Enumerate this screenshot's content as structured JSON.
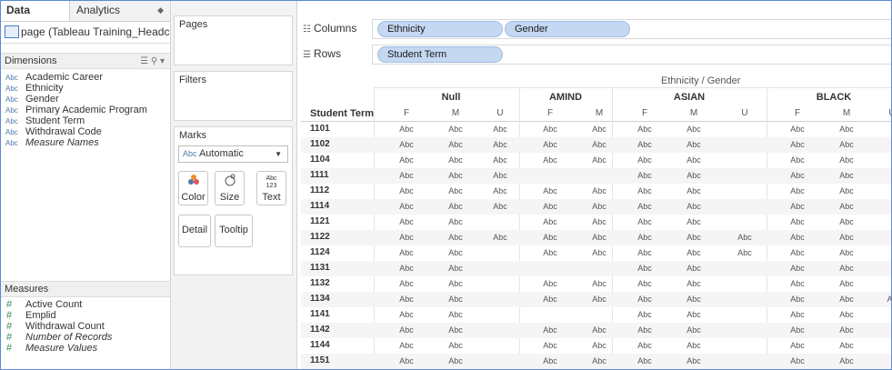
{
  "left_pane": {
    "tab_data": "Data",
    "tab_analytics": "Analytics",
    "datasource": "page (Tableau Training_Headc...",
    "dimensions_label": "Dimensions",
    "dimensions": [
      {
        "type": "Abc",
        "label": "Academic Career"
      },
      {
        "type": "Abc",
        "label": "Ethnicity"
      },
      {
        "type": "Abc",
        "label": "Gender"
      },
      {
        "type": "Abc",
        "label": "Primary Academic Program"
      },
      {
        "type": "Abc",
        "label": "Student Term"
      },
      {
        "type": "Abc",
        "label": "Withdrawal Code"
      },
      {
        "type": "Abc",
        "label": "Measure Names"
      }
    ],
    "measures_label": "Measures",
    "measures": [
      {
        "type": "#",
        "label": "Active Count"
      },
      {
        "type": "#",
        "label": "Emplid"
      },
      {
        "type": "#",
        "label": "Withdrawal Count"
      },
      {
        "type": "#",
        "label": "Number of Records"
      },
      {
        "type": "#",
        "label": "Measure Values"
      }
    ]
  },
  "cards": {
    "pages": "Pages",
    "filters": "Filters",
    "marks": "Marks",
    "mark_type_prefix": "Abc",
    "mark_type": "Automatic",
    "buttons": {
      "color": "Color",
      "size": "Size",
      "text": "Text",
      "detail": "Detail",
      "tooltip": "Tooltip"
    }
  },
  "shelves": {
    "columns_label": "Columns",
    "rows_label": "Rows",
    "columns": [
      "Ethnicity",
      "Gender"
    ],
    "rows": [
      "Student Term"
    ]
  },
  "table": {
    "title": "Ethnicity  /  Gender",
    "row_header": "Student Term",
    "groups": [
      {
        "name": "Null",
        "genders": [
          "F",
          "M",
          "U"
        ]
      },
      {
        "name": "AMIND",
        "genders": [
          "F",
          "M"
        ]
      },
      {
        "name": "ASIAN",
        "genders": [
          "F",
          "M",
          "U"
        ]
      },
      {
        "name": "BLACK",
        "genders": [
          "F",
          "M",
          "U"
        ]
      }
    ],
    "rows": [
      {
        "term": "1101",
        "cells": [
          "Abc",
          "Abc",
          "Abc",
          "Abc",
          "Abc",
          "Abc",
          "Abc",
          "",
          "Abc",
          "Abc",
          ""
        ]
      },
      {
        "term": "1102",
        "cells": [
          "Abc",
          "Abc",
          "Abc",
          "Abc",
          "Abc",
          "Abc",
          "Abc",
          "",
          "Abc",
          "Abc",
          ""
        ]
      },
      {
        "term": "1104",
        "cells": [
          "Abc",
          "Abc",
          "Abc",
          "Abc",
          "Abc",
          "Abc",
          "Abc",
          "",
          "Abc",
          "Abc",
          ""
        ]
      },
      {
        "term": "1111",
        "cells": [
          "Abc",
          "Abc",
          "Abc",
          "",
          "",
          "Abc",
          "Abc",
          "",
          "Abc",
          "Abc",
          ""
        ]
      },
      {
        "term": "1112",
        "cells": [
          "Abc",
          "Abc",
          "Abc",
          "Abc",
          "Abc",
          "Abc",
          "Abc",
          "",
          "Abc",
          "Abc",
          ""
        ]
      },
      {
        "term": "1114",
        "cells": [
          "Abc",
          "Abc",
          "Abc",
          "Abc",
          "Abc",
          "Abc",
          "Abc",
          "",
          "Abc",
          "Abc",
          ""
        ]
      },
      {
        "term": "1121",
        "cells": [
          "Abc",
          "Abc",
          "",
          "Abc",
          "Abc",
          "Abc",
          "Abc",
          "",
          "Abc",
          "Abc",
          ""
        ]
      },
      {
        "term": "1122",
        "cells": [
          "Abc",
          "Abc",
          "Abc",
          "Abc",
          "Abc",
          "Abc",
          "Abc",
          "Abc",
          "Abc",
          "Abc",
          ""
        ]
      },
      {
        "term": "1124",
        "cells": [
          "Abc",
          "Abc",
          "",
          "Abc",
          "Abc",
          "Abc",
          "Abc",
          "Abc",
          "Abc",
          "Abc",
          ""
        ]
      },
      {
        "term": "1131",
        "cells": [
          "Abc",
          "Abc",
          "",
          "",
          "",
          "Abc",
          "Abc",
          "",
          "Abc",
          "Abc",
          ""
        ]
      },
      {
        "term": "1132",
        "cells": [
          "Abc",
          "Abc",
          "",
          "Abc",
          "Abc",
          "Abc",
          "Abc",
          "",
          "Abc",
          "Abc",
          ""
        ]
      },
      {
        "term": "1134",
        "cells": [
          "Abc",
          "Abc",
          "",
          "Abc",
          "Abc",
          "Abc",
          "Abc",
          "",
          "Abc",
          "Abc",
          "Ab"
        ]
      },
      {
        "term": "1141",
        "cells": [
          "Abc",
          "Abc",
          "",
          "",
          "",
          "Abc",
          "Abc",
          "",
          "Abc",
          "Abc",
          ""
        ]
      },
      {
        "term": "1142",
        "cells": [
          "Abc",
          "Abc",
          "",
          "Abc",
          "Abc",
          "Abc",
          "Abc",
          "",
          "Abc",
          "Abc",
          ""
        ]
      },
      {
        "term": "1144",
        "cells": [
          "Abc",
          "Abc",
          "",
          "Abc",
          "Abc",
          "Abc",
          "Abc",
          "",
          "Abc",
          "Abc",
          ""
        ]
      },
      {
        "term": "1151",
        "cells": [
          "Abc",
          "Abc",
          "",
          "Abc",
          "Abc",
          "Abc",
          "Abc",
          "",
          "Abc",
          "Abc",
          ""
        ]
      }
    ]
  }
}
